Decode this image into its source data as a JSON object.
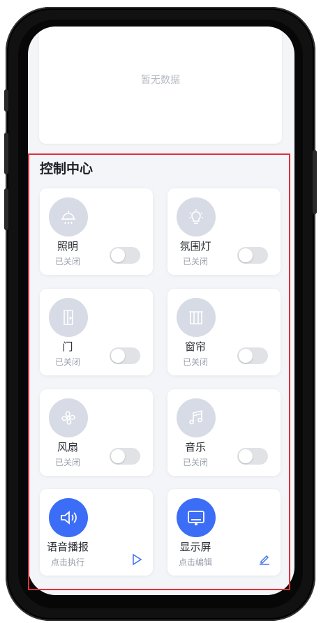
{
  "empty_state": {
    "text": "暂无数据"
  },
  "control_center": {
    "title": "控制中心",
    "devices": [
      {
        "label": "照明",
        "status": "已关闭",
        "icon": "ceiling-lamp-icon",
        "toggle_on": false
      },
      {
        "label": "氛围灯",
        "status": "已关闭",
        "icon": "light-bulb-icon",
        "toggle_on": false
      },
      {
        "label": "门",
        "status": "已关闭",
        "icon": "door-icon",
        "toggle_on": false
      },
      {
        "label": "窗帘",
        "status": "已关闭",
        "icon": "curtain-icon",
        "toggle_on": false
      },
      {
        "label": "风扇",
        "status": "已关闭",
        "icon": "fan-icon",
        "toggle_on": false
      },
      {
        "label": "音乐",
        "status": "已关闭",
        "icon": "music-note-icon",
        "toggle_on": false
      }
    ],
    "actions": [
      {
        "label": "语音播报",
        "sub": "点击执行",
        "icon": "speaker-icon",
        "action_icon": "play-icon"
      },
      {
        "label": "显示屏",
        "sub": "点击编辑",
        "icon": "monitor-icon",
        "action_icon": "edit-icon"
      }
    ]
  },
  "colors": {
    "accent": "#3b6df7",
    "icon_bg": "#d7dbe5",
    "outline": "#e0303b",
    "toggle_off": "#e0e2e6"
  }
}
